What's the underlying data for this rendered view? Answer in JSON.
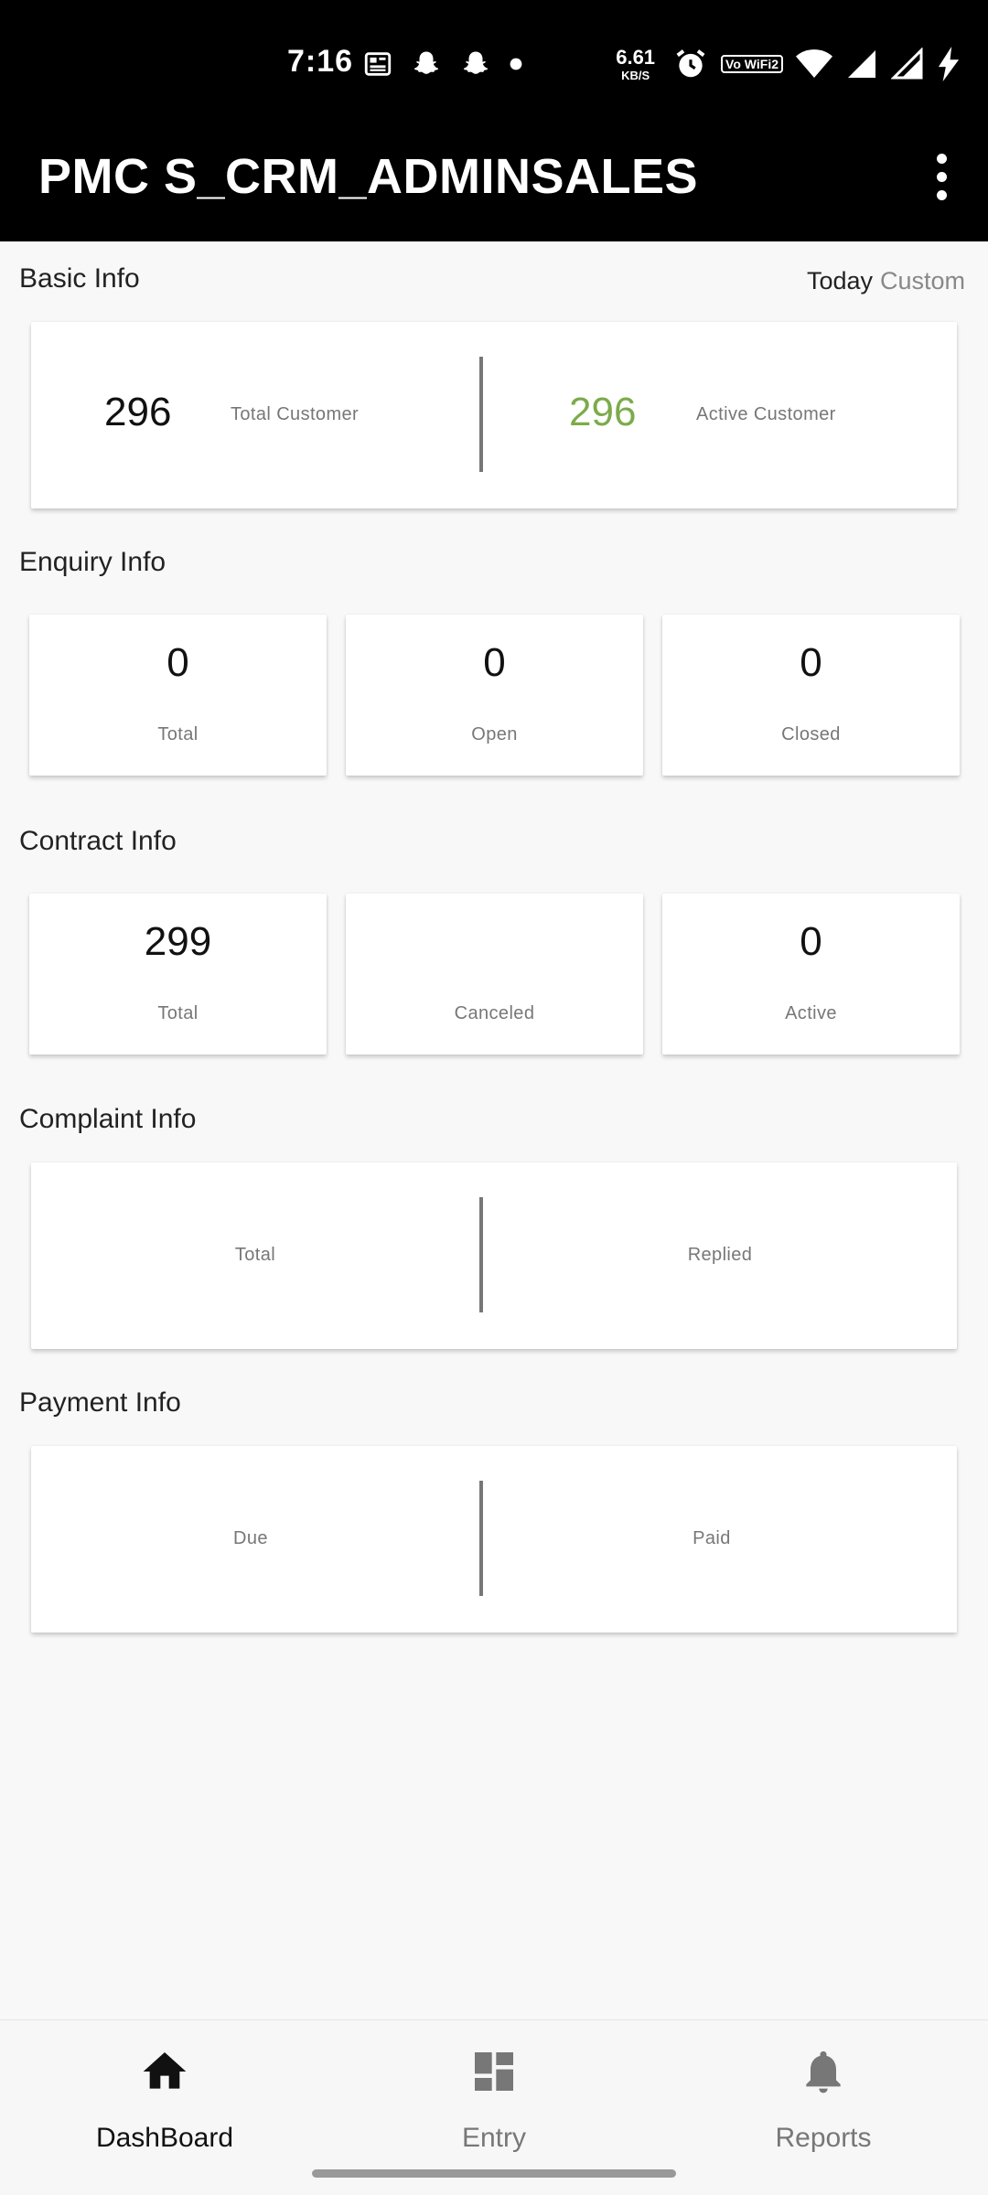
{
  "status_bar": {
    "time": "7:16",
    "net_speed_value": "6.61",
    "net_speed_unit": "KB/S",
    "wifi_label": "Vo WiFi2",
    "icons": [
      "news-icon",
      "snapchat-icon",
      "snapchat-icon",
      "dot-icon",
      "alarm-icon",
      "wifi-calling-icon",
      "wifi-icon",
      "signal-icon",
      "signal-icon",
      "charging-icon"
    ]
  },
  "app_bar": {
    "title": "PMC S_CRM_ADMINSALES"
  },
  "basic_info": {
    "title": "Basic Info",
    "filters": {
      "today": "Today",
      "custom": "Custom"
    },
    "total_customer_value": "296",
    "total_customer_label": "Total Customer",
    "active_customer_value": "296",
    "active_customer_label": "Active Customer",
    "active_color": "#7cab4b"
  },
  "enquiry_info": {
    "title": "Enquiry Info",
    "tiles": [
      {
        "value": "0",
        "label": "Total"
      },
      {
        "value": "0",
        "label": "Open"
      },
      {
        "value": "0",
        "label": "Closed"
      }
    ]
  },
  "contract_info": {
    "title": "Contract Info",
    "tiles": [
      {
        "value": "299",
        "label": "Total"
      },
      {
        "value": "",
        "label": "Canceled"
      },
      {
        "value": "0",
        "label": "Active"
      }
    ]
  },
  "complaint_info": {
    "title": "Complaint Info",
    "left_label": "Total",
    "right_label": "Replied"
  },
  "payment_info": {
    "title": "Payment Info",
    "left_label": "Due",
    "right_label": "Paid"
  },
  "bottom_nav": {
    "items": [
      {
        "label": "DashBoard",
        "icon": "home-icon",
        "active": true
      },
      {
        "label": "Entry",
        "icon": "dashboard-grid-icon",
        "active": false
      },
      {
        "label": "Reports",
        "icon": "bell-icon",
        "active": false
      }
    ]
  }
}
